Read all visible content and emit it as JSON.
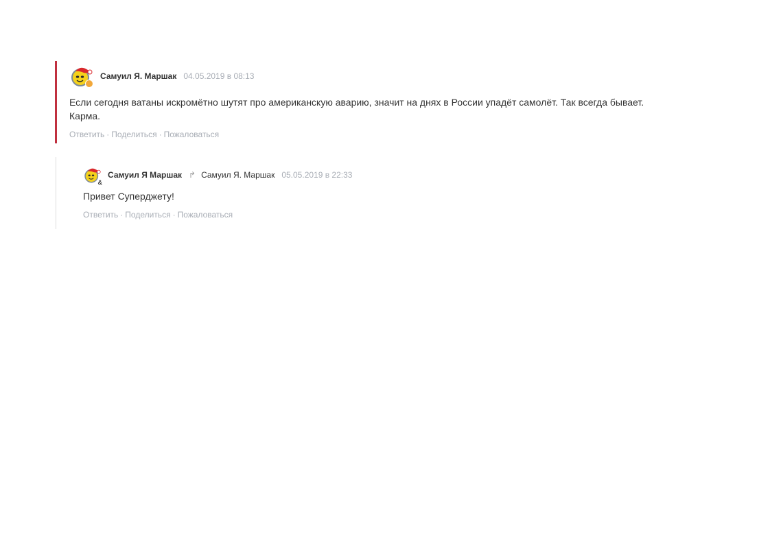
{
  "comments": [
    {
      "author": "Самуил Я. Маршак",
      "date": "04.05.2019 в 08:13",
      "text": "Если сегодня ватаны искромётно шутят про американскую аварию, значит на днях в России упадёт самолёт. Так всегда бывает. Карма.",
      "avatar_icon": "smiley-red-cap-avatar",
      "badge_color": "#f2a83a",
      "border_color": "#c0303f"
    },
    {
      "author": "Самуил Я Маршак",
      "reply_to": "Самуил Я. Маршак",
      "date": "05.05.2019 в 22:33",
      "text": "Привет Суперджету!",
      "avatar_icon": "smiley-red-cap-avatar",
      "badge_text": "&"
    }
  ],
  "actions": {
    "reply": "Ответить",
    "share": "Поделиться",
    "report": "Пожаловаться",
    "separator": "·"
  }
}
